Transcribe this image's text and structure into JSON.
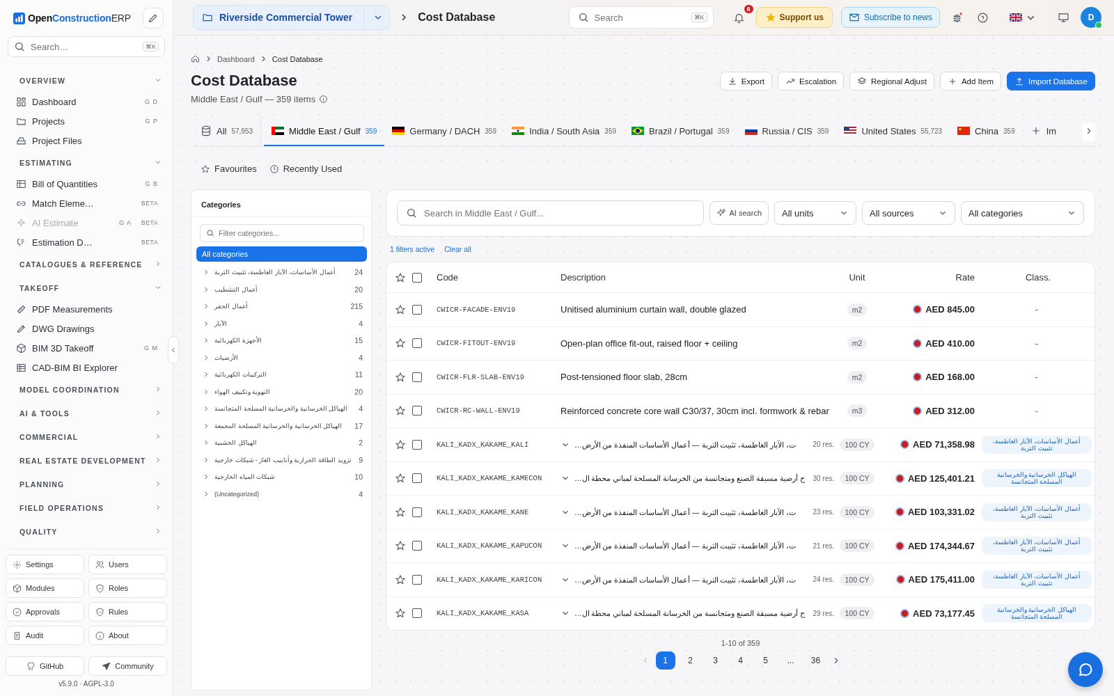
{
  "sidebar": {
    "brand": {
      "first": "Open",
      "second": "Construction",
      "third": "ERP"
    },
    "search": {
      "placeholder": "Search…",
      "shortcut": "⌘K"
    },
    "sections": [
      {
        "title": "OVERVIEW",
        "expanded": true,
        "items": [
          {
            "label": "Dashboard",
            "shortcut": "G D",
            "disabled": false
          },
          {
            "label": "Projects",
            "shortcut": "G P",
            "disabled": false
          },
          {
            "label": "Project Files",
            "disabled": false
          }
        ]
      },
      {
        "title": "ESTIMATING",
        "expanded": true,
        "items": [
          {
            "label": "Bill of Quantities",
            "shortcut": "G B",
            "disabled": false
          },
          {
            "label": "Match Eleme…",
            "badge": "BETA",
            "disabled": false
          },
          {
            "label": "AI Estimate",
            "shortcut": "G A",
            "badge": "BETA",
            "disabled": true
          },
          {
            "label": "Estimation D…",
            "badge": "BETA",
            "disabled": false
          }
        ]
      },
      {
        "title": "CATALOGUES & REFERENCE",
        "expanded": false
      },
      {
        "title": "TAKEOFF",
        "expanded": true,
        "items": [
          {
            "label": "PDF Measurements",
            "disabled": false
          },
          {
            "label": "DWG Drawings",
            "disabled": false
          },
          {
            "label": "BIM 3D Takeoff",
            "shortcut": "G M",
            "disabled": false
          },
          {
            "label": "CAD-BIM BI Explorer",
            "disabled": false
          }
        ]
      },
      {
        "title": "MODEL COORDINATION",
        "expanded": false
      },
      {
        "title": "AI & TOOLS",
        "expanded": false
      },
      {
        "title": "COMMERCIAL",
        "expanded": false
      },
      {
        "title": "REAL ESTATE DEVELOPMENT",
        "expanded": false
      },
      {
        "title": "PLANNING",
        "expanded": false
      },
      {
        "title": "FIELD OPERATIONS",
        "expanded": false
      },
      {
        "title": "QUALITY",
        "expanded": false
      }
    ],
    "admin_buttons": [
      "Settings",
      "Users",
      "Modules",
      "Roles",
      "Approvals",
      "Rules",
      "Audit",
      "About"
    ],
    "links": [
      "GitHub",
      "Community"
    ],
    "version": "v5.9.0 · AGPL-3.0"
  },
  "topbar": {
    "project": "Riverside Commercial Tower",
    "page": "Cost Database",
    "search": {
      "placeholder": "Search",
      "shortcut": "⌘K"
    },
    "notifications": "6",
    "support": "Support us",
    "subscribe": "Subscribe to news",
    "avatar": "D"
  },
  "breadcrumb": [
    "Dashboard",
    "Cost Database"
  ],
  "header": {
    "title": "Cost Database",
    "subtitle": "Middle East / Gulf — 359 items",
    "actions": [
      {
        "label": "Export",
        "kind": "secondary"
      },
      {
        "label": "Escalation",
        "kind": "secondary"
      },
      {
        "label": "Regional Adjust",
        "kind": "secondary"
      },
      {
        "label": "Add Item",
        "kind": "secondary"
      },
      {
        "label": "Import Database",
        "kind": "primary"
      }
    ]
  },
  "region_tabs": [
    {
      "kind": "all",
      "label": "All",
      "count": "57,953",
      "selected": false
    },
    {
      "kind": "region",
      "label": "Middle East / Gulf",
      "count": "359",
      "selected": true
    },
    {
      "kind": "region",
      "label": "Germany / DACH",
      "count": "359",
      "selected": false
    },
    {
      "kind": "region",
      "label": "India / South Asia",
      "count": "359",
      "selected": false
    },
    {
      "kind": "region",
      "label": "Brazil / Portugal",
      "count": "359",
      "selected": false
    },
    {
      "kind": "region",
      "label": "Russia / CIS",
      "count": "359",
      "selected": false
    },
    {
      "kind": "region",
      "label": "United States",
      "count": "55,723",
      "selected": false
    },
    {
      "kind": "region",
      "label": "China",
      "count": "359",
      "selected": false
    },
    {
      "kind": "add",
      "label": "Im",
      "selected": false
    }
  ],
  "sub_tabs": [
    "Favourites",
    "Recently Used"
  ],
  "categories": {
    "title": "Categories",
    "filter_placeholder": "Filter categories...",
    "items": [
      {
        "label": "All categories",
        "selected": true
      },
      {
        "label": "أعمال الأساسات، الآبار الغاطسة، تثبيت التربة",
        "count": "24",
        "selected": false
      },
      {
        "label": "أعمال التشطيب",
        "count": "20",
        "selected": false
      },
      {
        "label": "أعمال الحفر",
        "count": "215",
        "selected": false
      },
      {
        "label": "الآبار",
        "count": "4",
        "selected": false
      },
      {
        "label": "الأجهزة الكهربائية",
        "count": "15",
        "selected": false
      },
      {
        "label": "الأرضيات",
        "count": "4",
        "selected": false
      },
      {
        "label": "التركيبات الكهربائية",
        "count": "11",
        "selected": false
      },
      {
        "label": "التهوية وتكييف الهواء",
        "count": "20",
        "selected": false
      },
      {
        "label": "الهياكل الخرسانية والخرسانية المسلحة المتجانسة",
        "count": "4",
        "selected": false
      },
      {
        "label": "الهياكل الخرسانية والخرسانية المسلحة المجمعة",
        "count": "17",
        "selected": false
      },
      {
        "label": "الهياكل الخشبية",
        "count": "2",
        "selected": false
      },
      {
        "label": "تزويد الطاقة الحرارية وأنابيب الغاز - شبكات خارجية",
        "count": "9",
        "selected": false
      },
      {
        "label": "شبكات المياه الخارجية",
        "count": "10",
        "selected": false
      },
      {
        "label": "(Uncategorized)",
        "count": "4",
        "selected": false
      }
    ]
  },
  "filters": {
    "search_placeholder": "Search in Middle East / Gulf...",
    "ai_search": "AI search",
    "selects": [
      "All units",
      "All sources",
      "All categories"
    ],
    "active": "1 filters active",
    "clear": "Clear all"
  },
  "table": {
    "select_all_checked": false,
    "columns": [
      "Code",
      "Description",
      "Unit",
      "Rate",
      "Class."
    ],
    "rows": [
      {
        "kind": "item",
        "starred": false,
        "checked": false,
        "code": "CWICR-FACADE-ENV19",
        "description": "Unitised aluminium curtain wall, double glazed",
        "unit": "m2",
        "rate": "AED 845.00",
        "class": "-"
      },
      {
        "kind": "item",
        "starred": false,
        "checked": false,
        "code": "CWICR-FITOUT-ENV19",
        "description": "Open-plan office fit-out, raised floor + ceiling",
        "unit": "m2",
        "rate": "AED 410.00",
        "class": "-"
      },
      {
        "kind": "item",
        "starred": false,
        "checked": false,
        "code": "CWICR-FLR-SLAB-ENV19",
        "description": "Post-tensioned floor slab, 28cm",
        "unit": "m2",
        "rate": "AED 168.00",
        "class": "-"
      },
      {
        "kind": "item",
        "starred": false,
        "checked": false,
        "code": "CWICR-RC-WALL-ENV19",
        "description": "Reinforced concrete core wall C30/37, 30cm incl. formwork & rebar",
        "unit": "m3",
        "rate": "AED 312.00",
        "class": "-"
      },
      {
        "kind": "assembly",
        "starred": false,
        "checked": false,
        "code": "KALI_KADX_KAKAME_KALI",
        "description": "…ت، الآبار الغاطسة، تثبيت التربة — أعمال الأساسات المنفذة من الأرض",
        "resources": "20 res.",
        "unit": "100 CY",
        "rate": "AED 71,358.98",
        "class": "أعمال الأساسات، الآبار الغاطسة، تثبيت التربة"
      },
      {
        "kind": "assembly",
        "starred": false,
        "checked": false,
        "code": "KALI_KADX_KAKAME_KAMECON",
        "description": "…ح أرضية مسبقة الصنع ومتجانسة من الخرسانة المسلحة لمباني محطة ال",
        "resources": "30 res.",
        "unit": "100 CY",
        "rate": "AED 125,401.21",
        "class": "الهياكل الخرسانية والخرسانية المسلحة المتجانسة"
      },
      {
        "kind": "assembly",
        "starred": false,
        "checked": false,
        "code": "KALI_KADX_KAKAME_KANE",
        "description": "…ت، الآبار الغاطسة، تثبيت التربة — أعمال الأساسات المنفذة من الأرض",
        "resources": "23 res.",
        "unit": "100 CY",
        "rate": "AED 103,331.02",
        "class": "أعمال الأساسات، الآبار الغاطسة، تثبيت التربة"
      },
      {
        "kind": "assembly",
        "starred": false,
        "checked": false,
        "code": "KALI_KADX_KAKAME_KAPUCON",
        "description": "…ت، الآبار الغاطسة، تثبيت التربة — أعمال الأساسات المنفذة من الأرض",
        "resources": "21 res.",
        "unit": "100 CY",
        "rate": "AED 174,344.67",
        "class": "أعمال الأساسات، الآبار الغاطسة، تثبيت التربة"
      },
      {
        "kind": "assembly",
        "starred": false,
        "checked": false,
        "code": "KALI_KADX_KAKAME_KARICON",
        "description": "…ت، الآبار الغاطسة، تثبيت التربة — أعمال الأساسات المنفذة من الأرض",
        "resources": "24 res.",
        "unit": "100 CY",
        "rate": "AED 175,411.00",
        "class": "أعمال الأساسات، الآبار الغاطسة، تثبيت التربة"
      },
      {
        "kind": "assembly",
        "starred": false,
        "checked": false,
        "code": "KALI_KADX_KAKAME_KASA",
        "description": "…ح أرضية مسبقة الصنع ومتجانسة من الخرسانة المسلحة لمباني محطة ال",
        "resources": "29 res.",
        "unit": "100 CY",
        "rate": "AED 73,177.45",
        "class": "الهياكل الخرسانية والخرسانية المسلحة المتجانسة"
      }
    ]
  },
  "pagination": {
    "summary": "1-10 of 359",
    "pages": [
      {
        "label": "1",
        "selected": true
      },
      {
        "label": "2",
        "selected": false
      },
      {
        "label": "3",
        "selected": false
      },
      {
        "label": "4",
        "selected": false
      },
      {
        "label": "5",
        "selected": false
      },
      {
        "label": "...",
        "selected": false
      },
      {
        "label": "36",
        "selected": false
      }
    ]
  }
}
